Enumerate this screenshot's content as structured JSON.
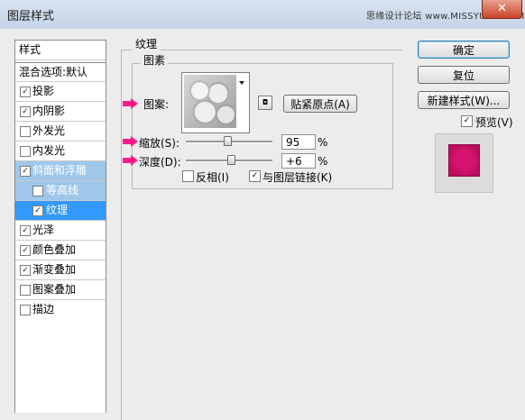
{
  "window": {
    "title": "图层样式",
    "watermark": "思缘设计论坛 www.MISSYUAN.COM",
    "close_glyph": "✕"
  },
  "style_list": {
    "header": "样式",
    "blend_options": "混合选项:默认",
    "items": [
      {
        "label": "投影",
        "checked": true
      },
      {
        "label": "内阴影",
        "checked": true
      },
      {
        "label": "外发光",
        "checked": false
      },
      {
        "label": "内发光",
        "checked": false
      },
      {
        "label": "斜面和浮雕",
        "checked": true
      },
      {
        "label": "等高线",
        "checked": false
      },
      {
        "label": "纹理",
        "checked": true
      },
      {
        "label": "光泽",
        "checked": true
      },
      {
        "label": "颜色叠加",
        "checked": true
      },
      {
        "label": "渐变叠加",
        "checked": true
      },
      {
        "label": "图案叠加",
        "checked": false
      },
      {
        "label": "描边",
        "checked": false
      }
    ]
  },
  "panel": {
    "title": "纹理",
    "group_title": "图素",
    "pattern_label": "图案:",
    "snap_button": "贴紧原点(A)",
    "scale_label": "缩放(S):",
    "scale_value": "95",
    "scale_unit": "%",
    "scale_slider_fraction": 0.47,
    "depth_label": "深度(D):",
    "depth_value": "+6",
    "depth_unit": "%",
    "depth_slider_fraction": 0.51,
    "invert_label": "反相(I)",
    "invert_checked": false,
    "link_label": "与图层链接(K)",
    "link_checked": true
  },
  "buttons": {
    "ok": "确定",
    "reset": "复位",
    "new_style": "新建样式(W)...",
    "preview_label": "预览(V)",
    "preview_checked": true
  },
  "colors": {
    "accent_arrow": "#ff1a8c",
    "preview_swatch": "#d61370",
    "selection": "#3399ff"
  }
}
